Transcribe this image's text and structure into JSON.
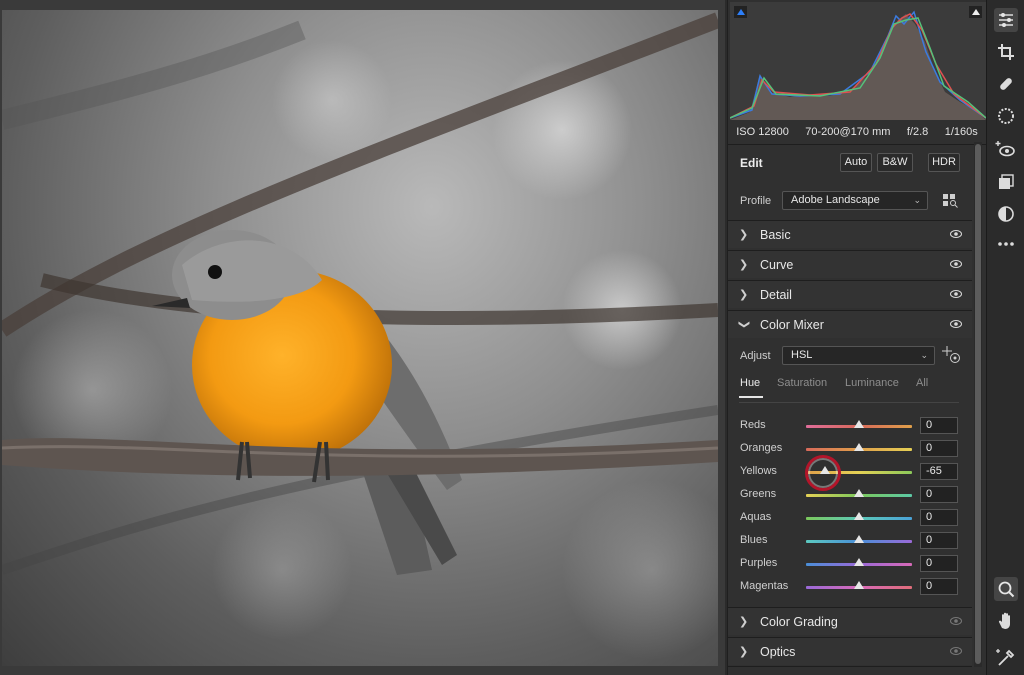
{
  "exif": {
    "iso": "ISO 12800",
    "lens": "70-200@170 mm",
    "aperture": "f/2.8",
    "shutter": "1/160s"
  },
  "edit": {
    "title": "Edit",
    "auto_label": "Auto",
    "bw_label": "B&W",
    "hdr_label": "HDR"
  },
  "profile": {
    "label": "Profile",
    "value": "Adobe Landscape"
  },
  "sections": {
    "basic": "Basic",
    "curve": "Curve",
    "detail": "Detail",
    "color_mixer": "Color Mixer",
    "color_grading": "Color Grading",
    "optics": "Optics"
  },
  "color_mixer": {
    "adjust_label": "Adjust",
    "adjust_value": "HSL",
    "tabs": [
      "Hue",
      "Saturation",
      "Luminance",
      "All"
    ],
    "active_tab": "Hue",
    "sliders": [
      {
        "label": "Reds",
        "value": "0",
        "position": 0.5
      },
      {
        "label": "Oranges",
        "value": "0",
        "position": 0.5
      },
      {
        "label": "Yellows",
        "value": "-65",
        "position": 0.175
      },
      {
        "label": "Greens",
        "value": "0",
        "position": 0.5
      },
      {
        "label": "Aquas",
        "value": "0",
        "position": 0.5
      },
      {
        "label": "Blues",
        "value": "0",
        "position": 0.5
      },
      {
        "label": "Purples",
        "value": "0",
        "position": 0.5
      },
      {
        "label": "Magentas",
        "value": "0",
        "position": 0.5
      }
    ]
  },
  "colors": {
    "focus_ring": "#b3152a",
    "accent_blue": "#2d7ff9"
  },
  "tools": [
    "edit-sliders-icon",
    "crop-icon",
    "healing-icon",
    "mask-icon",
    "redeye-icon",
    "presets-icon",
    "snapshots-icon",
    "more-icon",
    "zoom-icon",
    "hand-icon",
    "color-sampler-icon"
  ]
}
